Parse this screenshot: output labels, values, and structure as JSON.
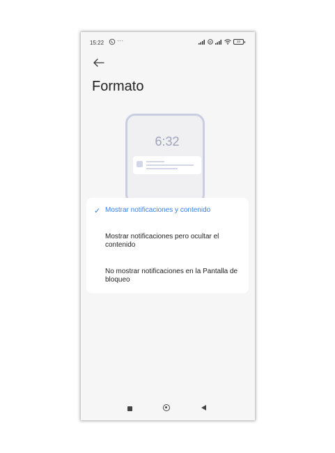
{
  "status_bar": {
    "time": "15:22",
    "extra": "···",
    "battery": "33",
    "icons": [
      "whatsapp-icon",
      "signal-icon",
      "nfc-icon",
      "signal-icon",
      "wifi-icon",
      "battery-icon"
    ]
  },
  "header": {
    "back_icon": "arrow-left-icon",
    "title": "Formato"
  },
  "illustration": {
    "clock": "6:32"
  },
  "options": [
    {
      "label": "Mostrar notificaciones y contenido",
      "selected": true,
      "check": "✓"
    },
    {
      "label": "Mostrar notificaciones pero ocultar el contenido",
      "selected": false
    },
    {
      "label": "No mostrar notificaciones en la Pantalla de bloqueo",
      "selected": false
    }
  ],
  "colors": {
    "accent": "#3a7ee6",
    "background": "#f6f6f6",
    "card": "#ffffff"
  },
  "nav_bar": {
    "icons": [
      "recents-icon",
      "home-icon",
      "back-icon"
    ]
  }
}
